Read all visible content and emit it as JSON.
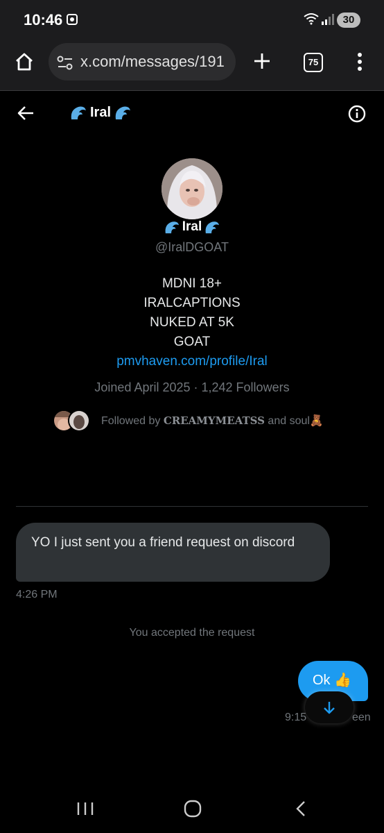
{
  "status_bar": {
    "time": "10:46",
    "network": "6",
    "battery": "30"
  },
  "browser": {
    "url": "x.com/messages/191",
    "tab_count": "75"
  },
  "conversation": {
    "title": "Iral"
  },
  "profile": {
    "name": "Iral",
    "handle": "@IralDGOAT",
    "bio_lines": [
      "MDNI 18+",
      "IRALCAPTIONS",
      "NUKED AT 5K",
      "GOAT"
    ],
    "link": "pmvhaven.com/profile/Iral",
    "joined": "Joined April 2025 · 1,242 Followers",
    "followed_by_prefix": "Followed by",
    "followed_by_name": "CREAMYMEATSS",
    "followed_by_suffix": "and soul🧸"
  },
  "messages": {
    "incoming_text": "YO I just sent you a friend request on discord",
    "incoming_time": "4:26 PM",
    "system_text": "You accepted the request",
    "outgoing_text": "Ok 👍",
    "outgoing_time": "9:15",
    "outgoing_status": "een"
  },
  "colors": {
    "accent": "#1d9bf0",
    "incoming_bubble": "#2f3336",
    "secondary_text": "#71767b"
  }
}
